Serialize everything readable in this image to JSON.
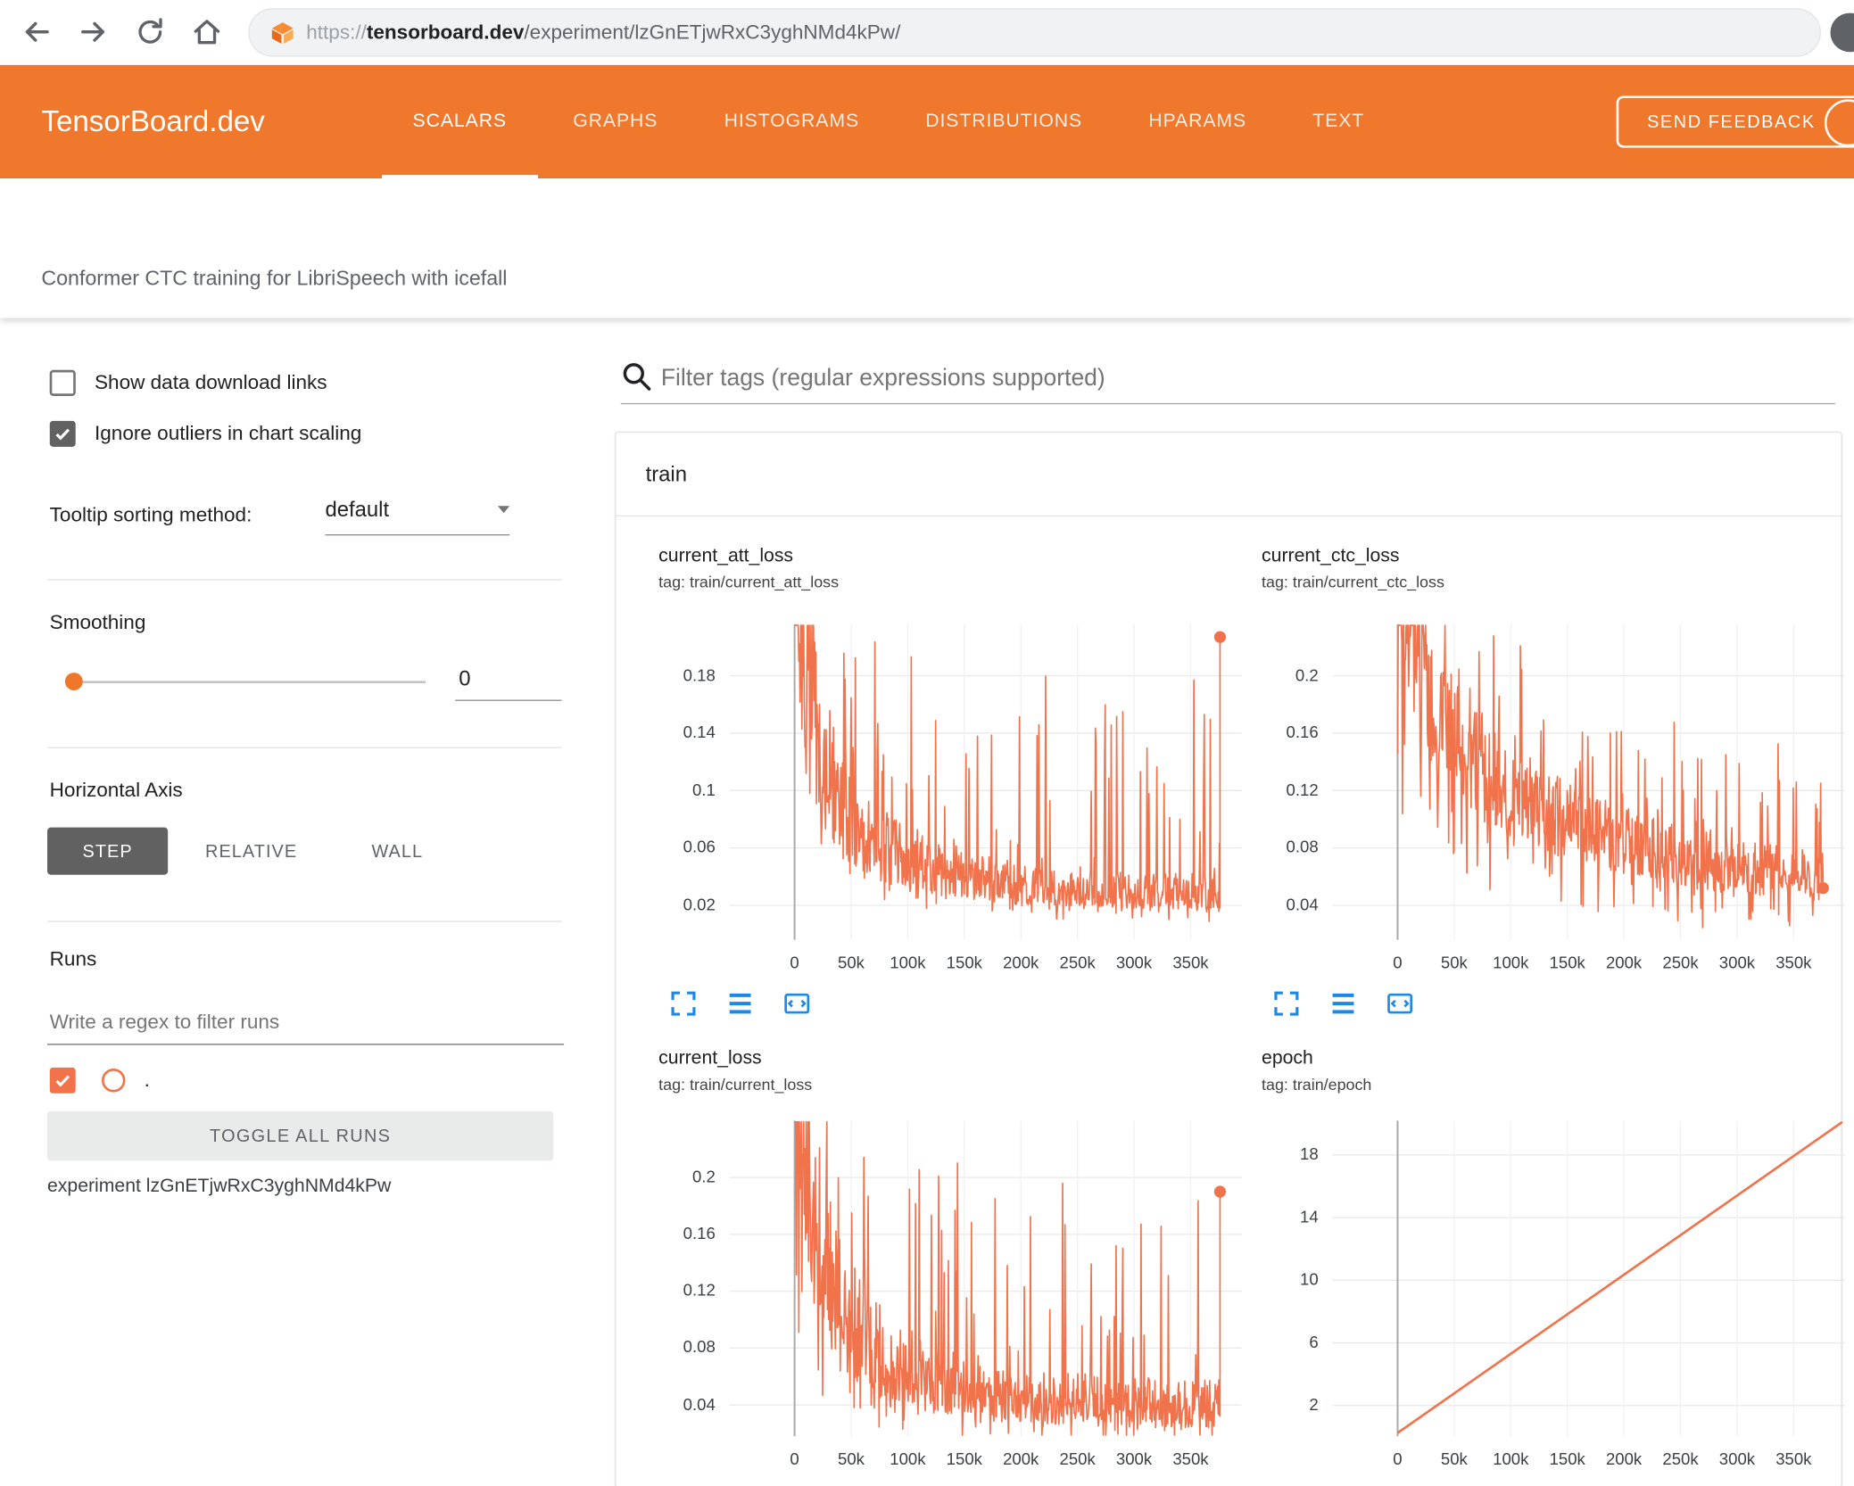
{
  "browser": {
    "url_scheme": "https://",
    "url_domain": "tensorboard.dev",
    "url_path": "/experiment/lzGnETjwRxC3yghNMd4kPw/"
  },
  "header": {
    "brand": "TensorBoard.dev",
    "tabs": [
      {
        "label": "SCALARS",
        "active": true
      },
      {
        "label": "GRAPHS",
        "active": false
      },
      {
        "label": "HISTOGRAMS",
        "active": false
      },
      {
        "label": "DISTRIBUTIONS",
        "active": false
      },
      {
        "label": "HPARAMS",
        "active": false
      },
      {
        "label": "TEXT",
        "active": false
      }
    ],
    "feedback_label": "SEND FEEDBACK"
  },
  "subtitle": "Conformer CTC training for LibriSpeech with icefall",
  "sidebar": {
    "show_download_label": "Show data download links",
    "ignore_outliers_label": "Ignore outliers in chart scaling",
    "tooltip_sorting_label": "Tooltip sorting method:",
    "tooltip_sorting_value": "default",
    "smoothing_label": "Smoothing",
    "smoothing_value": "0",
    "horizontal_axis_label": "Horizontal Axis",
    "axis_options": [
      {
        "label": "STEP",
        "selected": true
      },
      {
        "label": "RELATIVE",
        "selected": false
      },
      {
        "label": "WALL",
        "selected": false
      }
    ],
    "runs_label": "Runs",
    "runs_filter_placeholder": "Write a regex to filter runs",
    "run_item_label": ".",
    "toggle_all_label": "TOGGLE ALL RUNS",
    "experiment_label": "experiment lzGnETjwRxC3yghNMd4kPw"
  },
  "main": {
    "filter_placeholder": "Filter tags (regular expressions supported)",
    "section_label": "train"
  },
  "colors": {
    "header_orange": "#f0782c",
    "run_orange": "#f0734c",
    "icon_blue": "#1e88e5",
    "step_button_gray": "#616161"
  },
  "chart_data": [
    {
      "type": "line",
      "title": "current_att_loss",
      "tag": "tag: train/current_att_loss",
      "series_color": "#f0734c",
      "x_domain": [
        -57500,
        395000
      ],
      "y_domain": [
        -0.004,
        0.216
      ],
      "x_ticks": [
        {
          "v": 0,
          "label": "0"
        },
        {
          "v": 50000,
          "label": "50k"
        },
        {
          "v": 100000,
          "label": "100k"
        },
        {
          "v": 150000,
          "label": "150k"
        },
        {
          "v": 200000,
          "label": "200k"
        },
        {
          "v": 250000,
          "label": "250k"
        },
        {
          "v": 300000,
          "label": "300k"
        },
        {
          "v": 350000,
          "label": "350k"
        }
      ],
      "y_ticks": [
        {
          "v": 0.02,
          "label": "0.02"
        },
        {
          "v": 0.06,
          "label": "0.06"
        },
        {
          "v": 0.1,
          "label": "0.1"
        },
        {
          "v": 0.14,
          "label": "0.14"
        },
        {
          "v": 0.18,
          "label": "0.18"
        }
      ],
      "data_range": [
        0,
        376000
      ],
      "trend": [
        [
          0,
          0.3
        ],
        [
          10000,
          0.17
        ],
        [
          20000,
          0.12
        ],
        [
          40000,
          0.085
        ],
        [
          60000,
          0.065
        ],
        [
          80000,
          0.055
        ],
        [
          100000,
          0.05
        ],
        [
          130000,
          0.042
        ],
        [
          160000,
          0.036
        ],
        [
          200000,
          0.032
        ],
        [
          250000,
          0.03
        ],
        [
          300000,
          0.028
        ],
        [
          376000,
          0.027
        ]
      ],
      "noise": {
        "jitter": 0.45,
        "spike_prob": 0.1,
        "spike_abs": 0.15,
        "dip_prob": 0.12
      },
      "end_marker": [
        376000,
        0.207
      ],
      "toolbar": [
        "fullscreen-icon",
        "toggle-series-icon",
        "fit-domain-icon"
      ]
    },
    {
      "type": "line",
      "title": "current_ctc_loss",
      "tag": "tag: train/current_ctc_loss",
      "series_color": "#f0734c",
      "x_domain": [
        -57500,
        395000
      ],
      "y_domain": [
        0.016,
        0.236
      ],
      "x_ticks": [
        {
          "v": 0,
          "label": "0"
        },
        {
          "v": 50000,
          "label": "50k"
        },
        {
          "v": 100000,
          "label": "100k"
        },
        {
          "v": 150000,
          "label": "150k"
        },
        {
          "v": 200000,
          "label": "200k"
        },
        {
          "v": 250000,
          "label": "250k"
        },
        {
          "v": 300000,
          "label": "300k"
        },
        {
          "v": 350000,
          "label": "350k"
        }
      ],
      "y_ticks": [
        {
          "v": 0.04,
          "label": "0.04"
        },
        {
          "v": 0.08,
          "label": "0.08"
        },
        {
          "v": 0.12,
          "label": "0.12"
        },
        {
          "v": 0.16,
          "label": "0.16"
        },
        {
          "v": 0.2,
          "label": "0.2"
        }
      ],
      "data_range": [
        0,
        376000
      ],
      "trend": [
        [
          0,
          0.3
        ],
        [
          15000,
          0.22
        ],
        [
          30000,
          0.17
        ],
        [
          60000,
          0.14
        ],
        [
          100000,
          0.115
        ],
        [
          150000,
          0.095
        ],
        [
          200000,
          0.082
        ],
        [
          250000,
          0.072
        ],
        [
          300000,
          0.065
        ],
        [
          376000,
          0.058
        ]
      ],
      "noise": {
        "jitter": 0.28,
        "spike_prob": 0.1,
        "spike_abs": 0.09,
        "dip_prob": 0.1
      },
      "end_marker": [
        376000,
        0.052
      ],
      "toolbar": [
        "fullscreen-icon",
        "toggle-series-icon",
        "fit-domain-icon"
      ]
    },
    {
      "type": "line",
      "title": "current_loss",
      "tag": "tag: train/current_loss",
      "series_color": "#f0734c",
      "x_domain": [
        -57500,
        395000
      ],
      "y_domain": [
        0.018,
        0.24
      ],
      "x_ticks": [
        {
          "v": 0,
          "label": "0"
        },
        {
          "v": 50000,
          "label": "50k"
        },
        {
          "v": 100000,
          "label": "100k"
        },
        {
          "v": 150000,
          "label": "150k"
        },
        {
          "v": 200000,
          "label": "200k"
        },
        {
          "v": 250000,
          "label": "250k"
        },
        {
          "v": 300000,
          "label": "300k"
        },
        {
          "v": 350000,
          "label": "350k"
        }
      ],
      "y_ticks": [
        {
          "v": 0.04,
          "label": "0.04"
        },
        {
          "v": 0.08,
          "label": "0.08"
        },
        {
          "v": 0.12,
          "label": "0.12"
        },
        {
          "v": 0.16,
          "label": "0.16"
        },
        {
          "v": 0.2,
          "label": "0.2"
        }
      ],
      "data_range": [
        0,
        376000
      ],
      "trend": [
        [
          0,
          0.32
        ],
        [
          10000,
          0.2
        ],
        [
          20000,
          0.14
        ],
        [
          40000,
          0.1
        ],
        [
          60000,
          0.08
        ],
        [
          80000,
          0.068
        ],
        [
          100000,
          0.06
        ],
        [
          130000,
          0.052
        ],
        [
          160000,
          0.046
        ],
        [
          200000,
          0.042
        ],
        [
          250000,
          0.04
        ],
        [
          300000,
          0.038
        ],
        [
          376000,
          0.037
        ]
      ],
      "noise": {
        "jitter": 0.45,
        "spike_prob": 0.1,
        "spike_abs": 0.14,
        "dip_prob": 0.12
      },
      "end_marker": [
        376000,
        0.19
      ],
      "toolbar": null
    },
    {
      "type": "line",
      "title": "epoch",
      "tag": "tag: train/epoch",
      "series_color": "#f0734c",
      "x_domain": [
        -57500,
        395000
      ],
      "y_domain": [
        0.04,
        20.19
      ],
      "x_ticks": [
        {
          "v": 0,
          "label": "0"
        },
        {
          "v": 50000,
          "label": "50k"
        },
        {
          "v": 100000,
          "label": "100k"
        },
        {
          "v": 150000,
          "label": "150k"
        },
        {
          "v": 200000,
          "label": "200k"
        },
        {
          "v": 250000,
          "label": "250k"
        },
        {
          "v": 300000,
          "label": "300k"
        },
        {
          "v": 350000,
          "label": "350k"
        }
      ],
      "y_ticks": [
        {
          "v": 2,
          "label": "2"
        },
        {
          "v": 6,
          "label": "6"
        },
        {
          "v": 10,
          "label": "10"
        },
        {
          "v": 14,
          "label": "14"
        },
        {
          "v": 18,
          "label": "18"
        }
      ],
      "data_range": [
        0,
        393000
      ],
      "trend": [
        [
          0,
          0.25
        ],
        [
          393000,
          20.1
        ]
      ],
      "noise": null,
      "end_marker": null,
      "toolbar": null
    }
  ]
}
